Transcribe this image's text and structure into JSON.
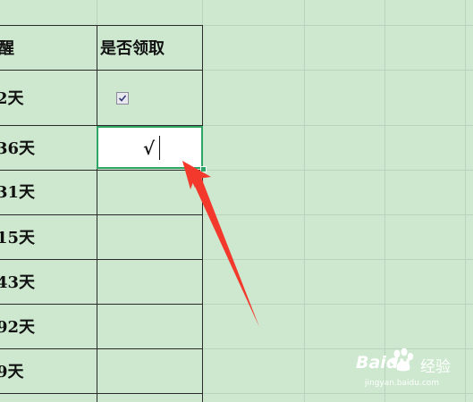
{
  "header": {
    "col_a_partial": "醒",
    "col_b": "是否领取"
  },
  "rows": [
    {
      "days": "2天",
      "received": "checkbox"
    },
    {
      "days": "36天",
      "received": "√"
    },
    {
      "days": "31天",
      "received": ""
    },
    {
      "days": "15天",
      "received": ""
    },
    {
      "days": "43天",
      "received": ""
    },
    {
      "days": "92天",
      "received": ""
    },
    {
      "days": "9天",
      "received": ""
    }
  ],
  "active_cell": {
    "value": "√"
  },
  "colors": {
    "background": "#cde8cf",
    "active_border": "#2fa665",
    "arrow": "#f2392c",
    "text": "#111111"
  },
  "watermark": {
    "brand": "Baidu",
    "product": "经验",
    "url": "jingyan.baidu.com"
  }
}
